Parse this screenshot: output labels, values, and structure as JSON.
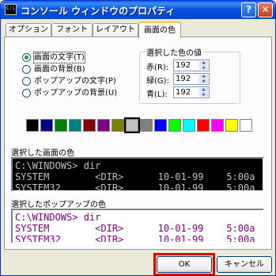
{
  "window": {
    "title": "コンソール ウィンドウのプロパティ",
    "icon_name": "console-window-icon",
    "icon_text": "C:\\",
    "help_label": "?",
    "close_label": "✕"
  },
  "tabs": [
    {
      "label": "オプション",
      "active": false
    },
    {
      "label": "フォント",
      "active": false
    },
    {
      "label": "レイアウト",
      "active": false
    },
    {
      "label": "画面の色",
      "active": true
    }
  ],
  "color_targets": [
    {
      "label": "画面の文字(T)",
      "checked": true
    },
    {
      "label": "画面の背景(B)",
      "checked": false
    },
    {
      "label": "ポップアップの文字(P)",
      "checked": false
    },
    {
      "label": "ポップアップの背景(U)",
      "checked": false
    }
  ],
  "selected_values": {
    "title": "選択した色の値",
    "red_label": "赤(R):",
    "green_label": "緑(G):",
    "blue_label": "青(L):",
    "red": "192",
    "green": "192",
    "blue": "192"
  },
  "palette": [
    "#000000",
    "#000080",
    "#008000",
    "#008080",
    "#800000",
    "#800080",
    "#808000",
    "#C0C0C0",
    "#808080",
    "#0000FF",
    "#00FF00",
    "#00FFFF",
    "#FF0000",
    "#FF00FF",
    "#FFFF00",
    "#FFFFFF"
  ],
  "selected_palette_index": 7,
  "screen_preview": {
    "label": "選択した画面の色",
    "text_color": "#C0C0C0",
    "bg_color": "#000000",
    "lines": [
      "C:\\WINDOWS> dir",
      "SYSTEM        <DIR>      10-01-99    5:00a",
      "SYSTEM32      <DIR>      10-01-99    5:00a"
    ]
  },
  "popup_preview": {
    "label": "選択したポップアップの色",
    "text_color": "#800080",
    "bg_color": "#FFFFFF",
    "lines": [
      "C:\\WINDOWS> dir",
      "SYSTEM        <DIR>      10-01-99    5:00a",
      "SYSTEM32      <DIR>      10-01-99    5:00a"
    ]
  },
  "buttons": {
    "ok": "OK",
    "cancel": "キャンセル"
  },
  "highlight_color": "#E00000"
}
